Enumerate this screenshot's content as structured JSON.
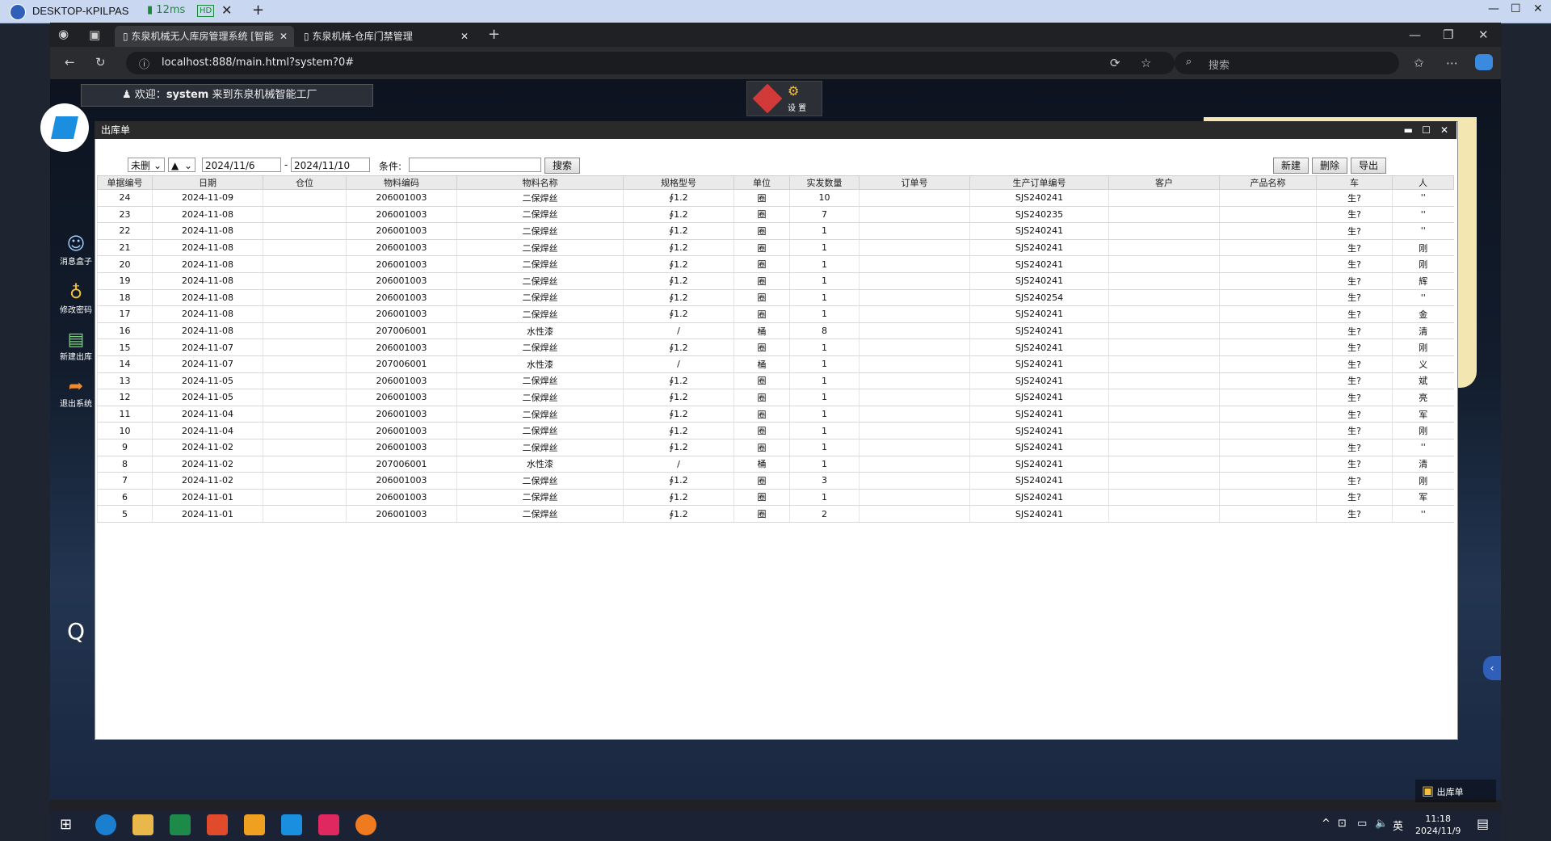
{
  "remote_bar": {
    "host": "DESKTOP-KPILPAS",
    "ping": "12ms",
    "quality": "HD"
  },
  "browser": {
    "tabs": [
      {
        "label": "东泉机械无人库房管理系统 [智能"
      },
      {
        "label": "东泉机械-仓库门禁管理"
      }
    ],
    "url": "localhost:888/main.html?system?0#",
    "search_placeholder": "搜索"
  },
  "app": {
    "welcome_prefix": "欢迎：",
    "username": "system",
    "welcome_suffix": "来到东泉机械智能工厂",
    "settings_label": "设 置",
    "sidebar": [
      {
        "label": "消息盒子",
        "icon": "chat-icon"
      },
      {
        "label": "修改密码",
        "icon": "lightbulb-icon"
      },
      {
        "label": "新建出库",
        "icon": "new-doc-icon"
      },
      {
        "label": "退出系统",
        "icon": "exit-arrow-icon"
      }
    ],
    "bottom_badge": "出库单"
  },
  "window": {
    "title": "出库单",
    "toolbar": {
      "status_select": "未删",
      "order_select": "▲",
      "date_from": "2024/11/6",
      "date_sep": "-",
      "date_to": "2024/11/10",
      "condition_label": "条件:",
      "condition_value": "",
      "search_label": "搜索",
      "new_label": "新建",
      "delete_label": "删除",
      "export_label": "导出"
    },
    "columns": [
      "单据编号",
      "日期",
      "仓位",
      "物料编码",
      "物料名称",
      "规格型号",
      "单位",
      "实发数量",
      "订单号",
      "生产订单编号",
      "客户",
      "产品名称",
      "车",
      "人"
    ],
    "rows": [
      [
        "24",
        "2024-11-09",
        "",
        "206001003",
        "二保焊丝",
        "∮1.2",
        "圈",
        "10",
        "",
        "SJS240241",
        "",
        "",
        "生?",
        "''"
      ],
      [
        "23",
        "2024-11-08",
        "",
        "206001003",
        "二保焊丝",
        "∮1.2",
        "圈",
        "7",
        "",
        "SJS240235",
        "",
        "",
        "生?",
        "''"
      ],
      [
        "22",
        "2024-11-08",
        "",
        "206001003",
        "二保焊丝",
        "∮1.2",
        "圈",
        "1",
        "",
        "SJS240241",
        "",
        "",
        "生?",
        "''"
      ],
      [
        "21",
        "2024-11-08",
        "",
        "206001003",
        "二保焊丝",
        "∮1.2",
        "圈",
        "1",
        "",
        "SJS240241",
        "",
        "",
        "生?",
        "刚"
      ],
      [
        "20",
        "2024-11-08",
        "",
        "206001003",
        "二保焊丝",
        "∮1.2",
        "圈",
        "1",
        "",
        "SJS240241",
        "",
        "",
        "生?",
        "刚"
      ],
      [
        "19",
        "2024-11-08",
        "",
        "206001003",
        "二保焊丝",
        "∮1.2",
        "圈",
        "1",
        "",
        "SJS240241",
        "",
        "",
        "生?",
        "辉"
      ],
      [
        "18",
        "2024-11-08",
        "",
        "206001003",
        "二保焊丝",
        "∮1.2",
        "圈",
        "1",
        "",
        "SJS240254",
        "",
        "",
        "生?",
        "''"
      ],
      [
        "17",
        "2024-11-08",
        "",
        "206001003",
        "二保焊丝",
        "∮1.2",
        "圈",
        "1",
        "",
        "SJS240241",
        "",
        "",
        "生?",
        "金"
      ],
      [
        "16",
        "2024-11-08",
        "",
        "207006001",
        "水性漆",
        "/",
        "桶",
        "8",
        "",
        "SJS240241",
        "",
        "",
        "生?",
        "清"
      ],
      [
        "15",
        "2024-11-07",
        "",
        "206001003",
        "二保焊丝",
        "∮1.2",
        "圈",
        "1",
        "",
        "SJS240241",
        "",
        "",
        "生?",
        "刚"
      ],
      [
        "14",
        "2024-11-07",
        "",
        "207006001",
        "水性漆",
        "/",
        "桶",
        "1",
        "",
        "SJS240241",
        "",
        "",
        "生?",
        "义"
      ],
      [
        "13",
        "2024-11-05",
        "",
        "206001003",
        "二保焊丝",
        "∮1.2",
        "圈",
        "1",
        "",
        "SJS240241",
        "",
        "",
        "生?",
        "斌"
      ],
      [
        "12",
        "2024-11-05",
        "",
        "206001003",
        "二保焊丝",
        "∮1.2",
        "圈",
        "1",
        "",
        "SJS240241",
        "",
        "",
        "生?",
        "亮"
      ],
      [
        "11",
        "2024-11-04",
        "",
        "206001003",
        "二保焊丝",
        "∮1.2",
        "圈",
        "1",
        "",
        "SJS240241",
        "",
        "",
        "生?",
        "军"
      ],
      [
        "10",
        "2024-11-04",
        "",
        "206001003",
        "二保焊丝",
        "∮1.2",
        "圈",
        "1",
        "",
        "SJS240241",
        "",
        "",
        "生?",
        "刚"
      ],
      [
        "9",
        "2024-11-02",
        "",
        "206001003",
        "二保焊丝",
        "∮1.2",
        "圈",
        "1",
        "",
        "SJS240241",
        "",
        "",
        "生?",
        "''"
      ],
      [
        "8",
        "2024-11-02",
        "",
        "207006001",
        "水性漆",
        "/",
        "桶",
        "1",
        "",
        "SJS240241",
        "",
        "",
        "生?",
        "清"
      ],
      [
        "7",
        "2024-11-02",
        "",
        "206001003",
        "二保焊丝",
        "∮1.2",
        "圈",
        "3",
        "",
        "SJS240241",
        "",
        "",
        "生?",
        "刚"
      ],
      [
        "6",
        "2024-11-01",
        "",
        "206001003",
        "二保焊丝",
        "∮1.2",
        "圈",
        "1",
        "",
        "SJS240241",
        "",
        "",
        "生?",
        "军"
      ],
      [
        "5",
        "2024-11-01",
        "",
        "206001003",
        "二保焊丝",
        "∮1.2",
        "圈",
        "2",
        "",
        "SJS240241",
        "",
        "",
        "生?",
        "''"
      ]
    ]
  },
  "taskbar": {
    "time": "11:18",
    "date": "2024/11/9",
    "ime": "英"
  },
  "colors": {
    "accent": "#2f5fb9",
    "window_title": "#2a2a2a",
    "browser_bg": "#202124"
  }
}
